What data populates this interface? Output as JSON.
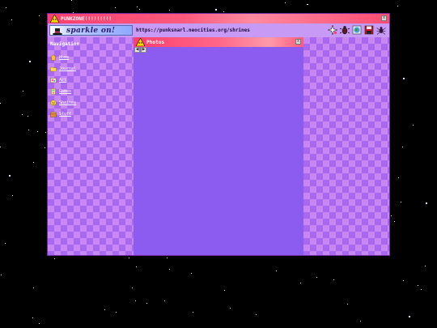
{
  "window": {
    "title": "PUNKZONE!!!!!!!!!",
    "close_label": "x"
  },
  "toolbar": {
    "banner_text": "sparkle on!",
    "url": "https://punksnarl.neocities.org/shrines",
    "icons": [
      "sparkle-icon",
      "bug-icon",
      "globe-icon",
      "floppy-disk-icon",
      "spider-icon"
    ]
  },
  "sidebar": {
    "title": "Navigation",
    "items": [
      {
        "label": "Home",
        "icon": "home-icon"
      },
      {
        "label": "Journal",
        "icon": "folder-icon"
      },
      {
        "label": "Art",
        "icon": "art-icon"
      },
      {
        "label": "Games",
        "icon": "games-icon"
      },
      {
        "label": "Shrines",
        "icon": "shrines-icon"
      },
      {
        "label": "Stuff",
        "icon": "stuff-icon"
      }
    ]
  },
  "photos_window": {
    "title": "Photos",
    "close_label": "x",
    "back_label": "◀",
    "forward_label": "▶"
  },
  "colors": {
    "titlebar": "#ff4d73",
    "window_bg": "#b06cf2",
    "content_bg": "#8c5cf0",
    "checker_light": "#c788f4",
    "checker_dark": "#a868f0"
  }
}
